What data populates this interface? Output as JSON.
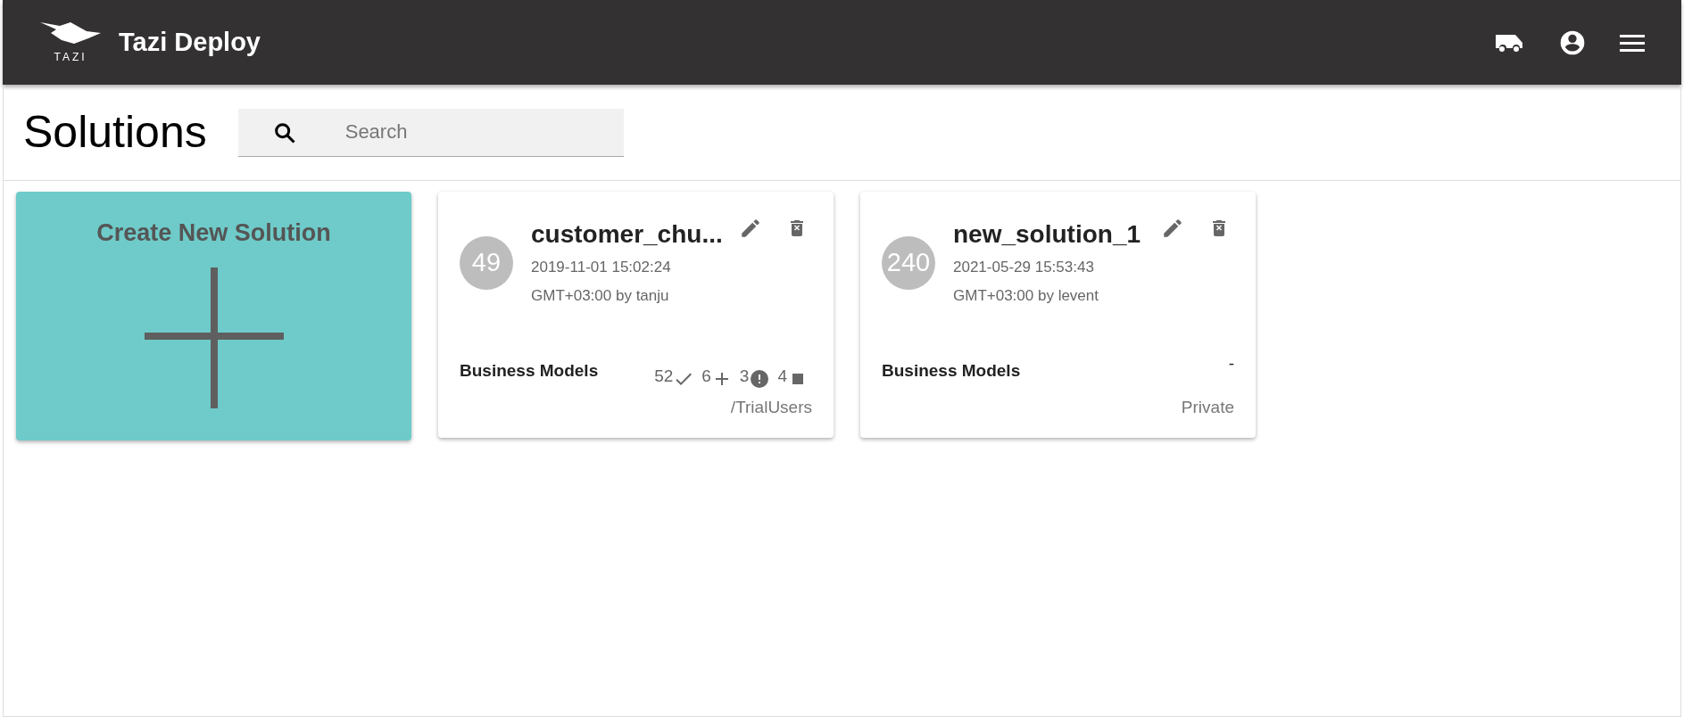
{
  "header": {
    "logo_text": "TAZI",
    "title": "Tazi Deploy"
  },
  "page": {
    "title": "Solutions",
    "search": {
      "placeholder": "Search"
    }
  },
  "create_card": {
    "label": "Create New Solution"
  },
  "solutions": [
    {
      "count": "49",
      "name": "customer_chu...",
      "date": "2019-11-01 15:02:24",
      "author_line": "GMT+03:00 by tanju",
      "models_label": "Business Models",
      "stats": [
        {
          "value": "52",
          "kind": "check"
        },
        {
          "value": "6",
          "kind": "plus"
        },
        {
          "value": "3",
          "kind": "alert"
        },
        {
          "value": "4",
          "kind": "stop"
        }
      ],
      "footer": "/TrialUsers"
    },
    {
      "count": "240",
      "name": "new_solution_1",
      "date": "2021-05-29 15:53:43",
      "author_line": "GMT+03:00 by levent",
      "models_label": "Business Models",
      "empty_stats": "-",
      "footer": "Private"
    }
  ]
}
